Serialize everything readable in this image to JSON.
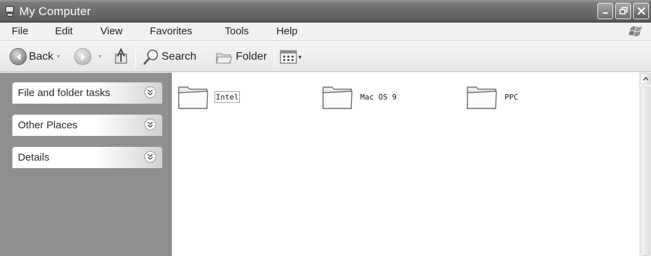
{
  "window": {
    "title": "My Computer"
  },
  "menu": {
    "items": [
      "File",
      "Edit",
      "View",
      "Favorites",
      "Tools",
      "Help"
    ]
  },
  "toolbar": {
    "back_label": "Back",
    "search_label": "Search",
    "folder_label": "Folder"
  },
  "task_panels": [
    {
      "label": "File and folder tasks"
    },
    {
      "label": "Other Places"
    },
    {
      "label": "Details"
    }
  ],
  "folders": [
    {
      "name": "Intel",
      "selected": true
    },
    {
      "name": "Mac OS 9",
      "selected": false
    },
    {
      "name": "PPC",
      "selected": false
    }
  ],
  "icons": {
    "app": "my-computer-icon",
    "minimize": "minimize-icon",
    "restore": "restore-icon",
    "close": "close-icon",
    "windows_logo": "windows-logo-icon",
    "back": "back-arrow-icon",
    "forward": "forward-arrow-icon",
    "up": "up-folder-icon",
    "search": "search-icon",
    "folders": "folders-icon",
    "views": "views-icon",
    "expand": "chevron-down-icon",
    "folder": "folder-icon"
  },
  "colors": {
    "title_bar": "#6c6c6c",
    "task_pane": "#8f8f8f"
  }
}
